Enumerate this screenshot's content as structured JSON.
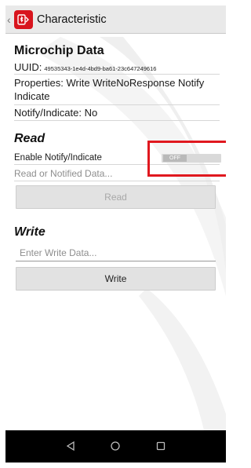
{
  "app_bar": {
    "title": "Characteristic",
    "icons": [
      "back-chevron-icon",
      "app-logo-icon"
    ]
  },
  "details": {
    "title": "Microchip Data",
    "uuid_label": "UUID:",
    "uuid_value": "49535343-1e4d-4bd9-ba61-23c647249616",
    "properties": "Properties: Write WriteNoResponse Notify Indicate",
    "notify_indicate": "Notify/Indicate: No"
  },
  "read": {
    "title": "Read",
    "enable_label": "Enable Notify/Indicate",
    "toggle_label": "OFF",
    "toggle_on": false,
    "data_placeholder": "Read or Notified Data...",
    "button_label": "Read"
  },
  "write": {
    "title": "Write",
    "input_value": "",
    "input_placeholder": "Enter Write Data...",
    "button_label": "Write"
  },
  "nav": {
    "icons": [
      "nav-back-icon",
      "nav-home-icon",
      "nav-recents-icon"
    ]
  },
  "colors": {
    "highlight": "#e0181f",
    "logo": "#d8141d",
    "app_bar": "#e9e9e9",
    "button": "#e2e2e2",
    "nav_bar": "#000000"
  }
}
